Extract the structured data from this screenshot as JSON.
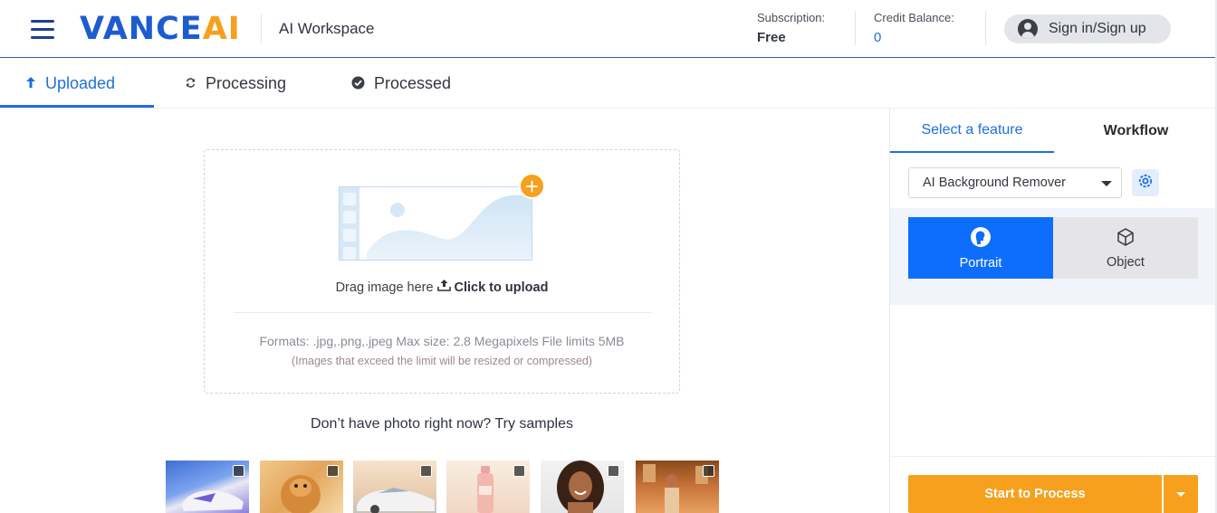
{
  "header": {
    "logo_left": "VANCE",
    "logo_right": "AI",
    "workspace": "AI Workspace",
    "subscription_label": "Subscription:",
    "subscription_value": "Free",
    "credit_label": "Credit Balance:",
    "credit_value": "0",
    "signin_label": "Sign in/Sign up"
  },
  "tabs": [
    {
      "label": "Uploaded",
      "icon": "upload-arrow-icon",
      "active": true
    },
    {
      "label": "Processing",
      "icon": "refresh-icon",
      "active": false
    },
    {
      "label": "Processed",
      "icon": "check-circle-icon",
      "active": false
    }
  ],
  "upload": {
    "drag_text": "Drag image here",
    "click_text": "Click to upload",
    "formats": "Formats: .jpg,.png,.jpeg Max size: 2.8 Megapixels File limits 5MB",
    "note": "(Images that exceed the limit will be resized or compressed)"
  },
  "samples": {
    "title": "Don’t have photo right now? Try samples",
    "items": [
      "sneakers",
      "puppy",
      "car",
      "bottle",
      "woman",
      "man"
    ]
  },
  "right_panel": {
    "tabs": [
      "Select a feature",
      "Workflow"
    ],
    "feature_select": "AI Background Remover",
    "modes": [
      "Portrait",
      "Object"
    ],
    "process_button": "Start to Process"
  },
  "colors": {
    "accent": "#1d6fe0",
    "brand_orange": "#f7a01d",
    "active_mode": "#0d6efd"
  }
}
